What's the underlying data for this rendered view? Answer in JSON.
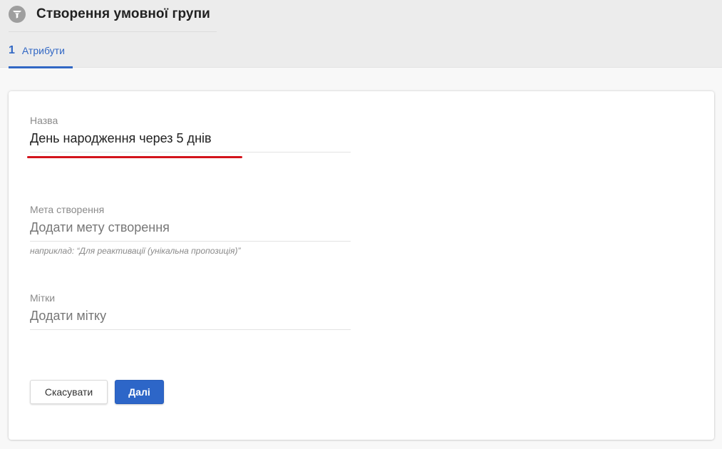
{
  "header": {
    "title": "Створення умовної групи",
    "icon": "filter-icon"
  },
  "steps": [
    {
      "number": "1",
      "label": "Атрибути",
      "active": true
    }
  ],
  "form": {
    "name": {
      "label": "Назва",
      "value": "День народження через 5 днів"
    },
    "goal": {
      "label": "Мета створення",
      "value": "",
      "placeholder": "Додати мету створення",
      "hint": "наприклад: “Для реактивації (унікальна пропозиція)”"
    },
    "tags": {
      "label": "Мітки",
      "value": "",
      "placeholder": "Додати мітку"
    }
  },
  "actions": {
    "cancel_label": "Скасувати",
    "next_label": "Далі"
  },
  "colors": {
    "accent": "#3167c4",
    "button_primary": "#2d66c8",
    "highlight_underline": "#d3141c"
  }
}
